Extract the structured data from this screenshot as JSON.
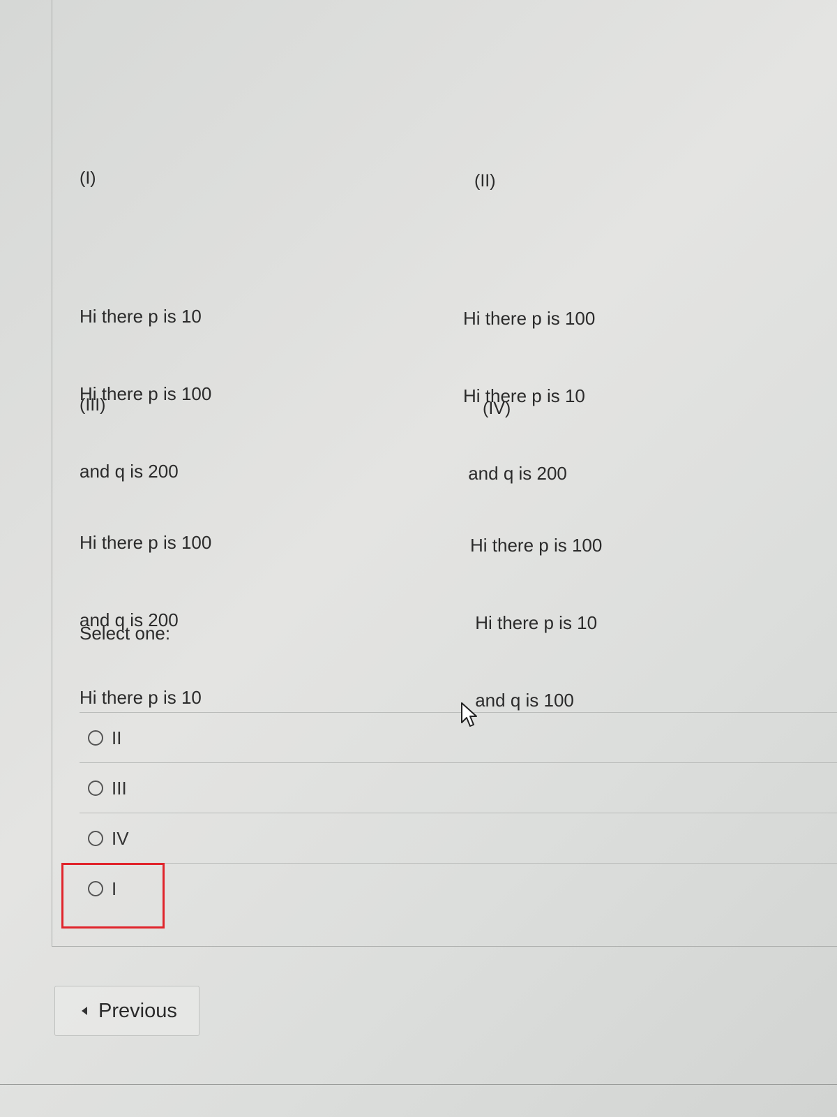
{
  "options": {
    "i": {
      "label": "(I)",
      "lines": [
        "Hi there p is 10",
        "Hi there p is 100",
        "and q is 200"
      ]
    },
    "ii": {
      "label": "(II)",
      "lines": [
        "Hi there p is 100",
        "Hi there p is 10",
        " and q is 200"
      ]
    },
    "iii": {
      "label": "(III)",
      "lines": [
        "Hi there p is 100",
        "and q is 200",
        "Hi there p is 10"
      ]
    },
    "iv": {
      "label": "(IV)",
      "lines": [
        "Hi there p is 100",
        " Hi there p is 10",
        " and q is 100"
      ]
    }
  },
  "prompt": "Select one:",
  "answers": [
    {
      "label": "II",
      "selected": false
    },
    {
      "label": "III",
      "selected": false
    },
    {
      "label": "IV",
      "selected": false
    },
    {
      "label": "I",
      "selected": false
    }
  ],
  "highlight_color": "#e0242b",
  "navigation": {
    "previous_label": "Previous",
    "previous_icon": "caret-left-icon"
  },
  "cursor_icon": "mouse-pointer-icon"
}
